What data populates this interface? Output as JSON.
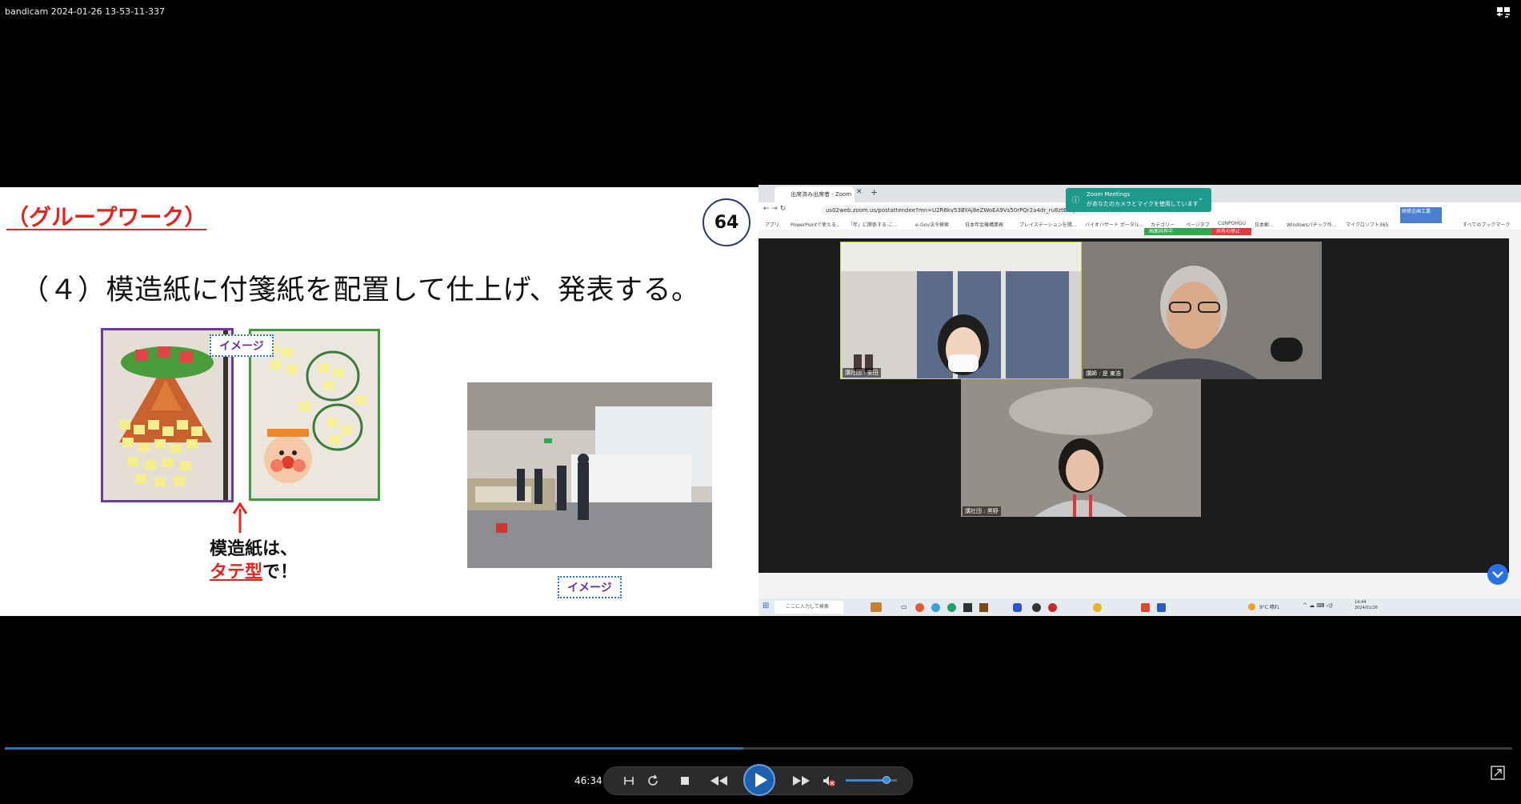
{
  "window": {
    "title": "bandicam 2024-01-26 13-53-11-337"
  },
  "slide": {
    "heading": "（グループワーク）",
    "number": "64",
    "body": "（４）模造紙に付箋紙を配置して仕上げ、発表する。",
    "image_tag": "イメージ",
    "photo_tag": "イメージ",
    "note_line1": "模造紙は、",
    "note_em": "タテ型",
    "note_tail": "で！"
  },
  "browser": {
    "tab_title": "出席済み出席者 - Zoom",
    "url": "us02web.zoom.us/postattendee?mn=U2R6kv53BYAj8eZWoEA9Vs50rPQr2a4dr_ru8ztBrcyN6tIaM5Pl",
    "bookmarks": [
      "アプリ",
      "PowerPointで使える...",
      "「年」に関係する-こ...",
      "e-Gov法令検索",
      "日本年金機構業務",
      "プレイステーションを開...",
      "バイオハザード ポータル...",
      "カテゴリー",
      "ページタブ",
      "CUNPOHGU",
      "日本郵...",
      "Windowsパチック作...",
      "マイクロソフト365",
      "すべてのブックマーク"
    ],
    "notification": {
      "title": "Zoom Meetings",
      "message": "があなたのカメラとマイクを使用しています"
    },
    "sharing_label": "画面共有中",
    "stop_share_label": "共有の停止",
    "badge_text": "研修企画工業"
  },
  "meeting": {
    "participants": [
      {
        "label": "講社団 : 安田"
      },
      {
        "label": "講師 : 是 東浩"
      },
      {
        "label": "講社団 : 黒野"
      }
    ]
  },
  "taskbar": {
    "search_placeholder": "ここに入力して検索",
    "weather": "9°C 晴れ",
    "clock_time": "14:44",
    "clock_date": "2024/01/26"
  },
  "player": {
    "time": "46:34",
    "progress": 0.49,
    "volume": 0.8
  }
}
